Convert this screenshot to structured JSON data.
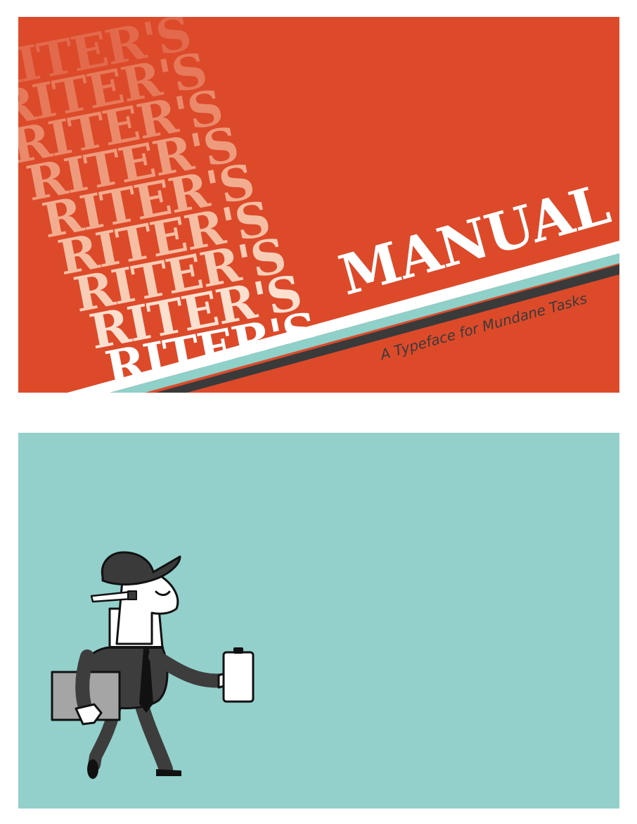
{
  "cover": {
    "repeated_word": "RITER'S",
    "title_word": "MANUAL",
    "tagline": "A Typeface for Mundane Tasks",
    "colors": {
      "background": "#dc4a2a",
      "stripe_white": "#ffffff",
      "stripe_teal": "#8fd0c9",
      "stripe_dark": "#3a3a3a",
      "tagline": "#3a3a3a",
      "fade_steps": [
        "#e2694c",
        "#e6795a",
        "#ea8a6b",
        "#ee9b7d",
        "#f2ad90",
        "#f5bea3",
        "#f8cdb6",
        "#fbe0d0",
        "#ffffff"
      ]
    }
  },
  "illustration": {
    "background": "#93d0cb",
    "subject": "businessman-walking",
    "icons": [
      "bowler-hat-icon",
      "pencil-icon",
      "clipboard-icon",
      "folder-icon",
      "necktie-icon"
    ],
    "colors": {
      "suit": "#3d3d3d",
      "hat": "#3a3a3a",
      "skin": "#ffffff",
      "folder": "#a5a5a5",
      "outline": "#111111"
    }
  }
}
